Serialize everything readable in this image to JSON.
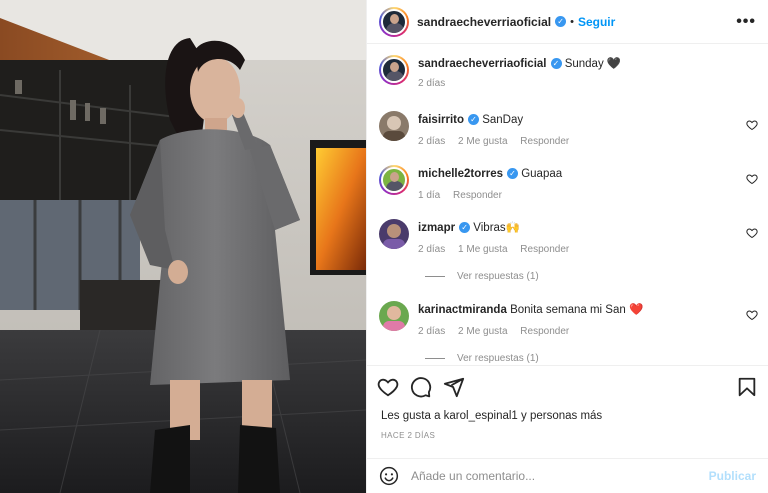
{
  "post": {
    "author": "sandraecheverriaoficial",
    "follow_label": "Seguir",
    "dot": "•",
    "more_label": "•••",
    "verified_glyph": "✓",
    "caption": "Sunday",
    "caption_emoji": "🖤",
    "caption_time": "2 días"
  },
  "comments": [
    {
      "user": "faisirrito",
      "text": "SanDay",
      "time": "2 días",
      "likes": "2 Me gusta",
      "reply": "Responder",
      "avatar_color": "#8a7a6a"
    },
    {
      "user": "michelle2torres",
      "text": "Guapaa",
      "time": "1 día",
      "likes": "",
      "reply": "Responder",
      "avatar_color": "#7cb342"
    },
    {
      "user": "izmapr",
      "text": "Vibras🙌",
      "time": "2 días",
      "likes": "1 Me gusta",
      "reply": "Responder",
      "avatar_color": "#4a3b6b",
      "replies_label": "Ver respuestas (1)"
    },
    {
      "user": "karinactmiranda",
      "text": "Bonita semana mi San",
      "text_emoji": "❤️",
      "time": "2 días",
      "likes": "2 Me gusta",
      "reply": "Responder",
      "avatar_color": "#6aa84f",
      "replies_label": "Ver respuestas (1)"
    }
  ],
  "likes_text": "Les gusta a karol_espinal1 y personas más",
  "time_ago": "HACE 2 DÍAS",
  "composer": {
    "placeholder": "Añade un comentario...",
    "post_label": "Publicar"
  },
  "icons": [
    "heart-icon",
    "comment-icon",
    "share-icon",
    "bookmark-icon",
    "emoji-icon",
    "more-icon",
    "verified-icon"
  ],
  "colors": {
    "accent": "#0095f6",
    "verified": "#3897f0",
    "heart_red": "#ed4956",
    "muted": "#8e8e8e"
  }
}
